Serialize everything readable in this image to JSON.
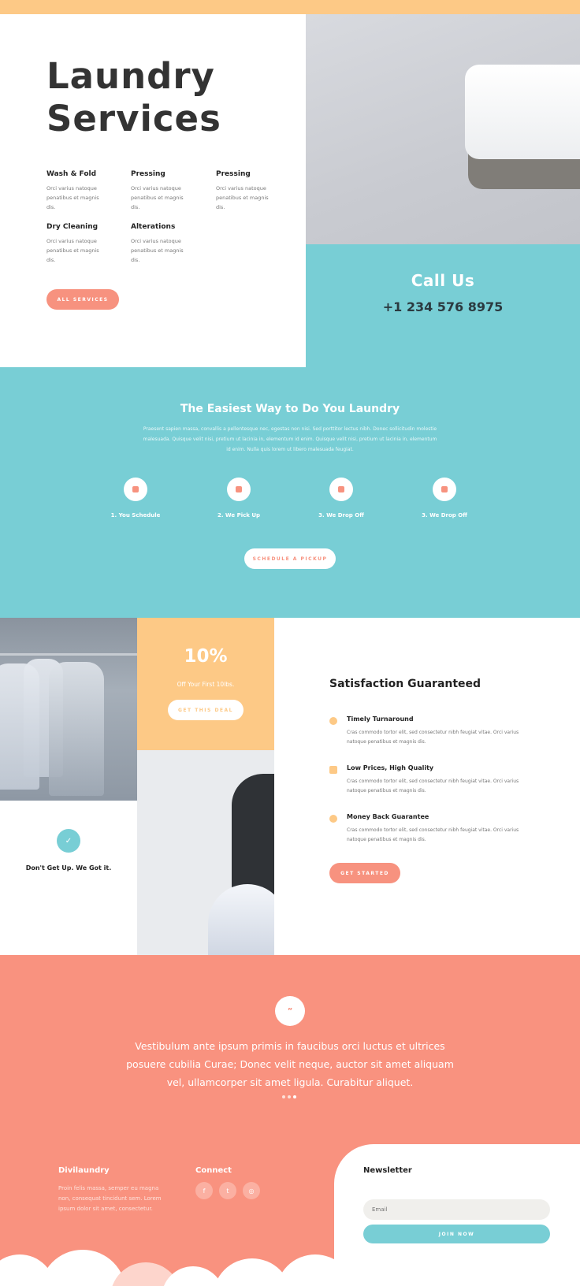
{
  "hero": {
    "title_line1": "Laundry",
    "title_line2": "Services",
    "services": [
      {
        "title": "Wash & Fold",
        "desc": "Orci varius natoque penatibus et magnis dis."
      },
      {
        "title": "Pressing",
        "desc": "Orci varius natoque penatibus et magnis dis."
      },
      {
        "title": "Pressing",
        "desc": "Orci varius natoque penatibus et magnis dis."
      },
      {
        "title": "Dry Cleaning",
        "desc": "Orci varius natoque penatibus et magnis dis."
      },
      {
        "title": "Alterations",
        "desc": "Orci varius natoque penatibus et magnis dis."
      }
    ],
    "button_label": "ALL SERVICES"
  },
  "call": {
    "title": "Call Us",
    "phone": "+1 234 576 8975"
  },
  "easy": {
    "title": "The Easiest Way to Do You Laundry",
    "text": "Praesent sapien massa, convallis a pellentesque nec, egestas non nisi. Sed porttitor lectus nibh. Donec sollicitudin molestie malesuada. Quisque velit nisi, pretium ut lacinia in, elementum id enim. Quisque velit nisi, pretium ut lacinia in, elementum id enim. Nulla quis lorem ut libero malesuada feugiat.",
    "steps": [
      {
        "label": "1. You Schedule",
        "icon": "calendar-icon"
      },
      {
        "label": "2. We Pick Up",
        "icon": "basket-icon"
      },
      {
        "label": "3. We Drop Off",
        "icon": "bag-icon"
      },
      {
        "label": "3. We Drop Off",
        "icon": "bag-icon"
      }
    ],
    "button_label": "SCHEDULE A PICKUP"
  },
  "deal": {
    "percent": "10%",
    "subtitle": "Off Your First 10lbs.",
    "button_label": "GET THIS DEAL"
  },
  "promise": {
    "icon": "check-icon",
    "check_glyph": "✓",
    "label": "Don't Get Up. We Got it."
  },
  "satisfaction": {
    "title": "Satisfaction Guaranteed",
    "features": [
      {
        "title": "Timely Turnaround",
        "desc": "Cras commodo tortor elit, sed consectetur nibh feugiat vitae. Orci varius natoque penatibus et magnis dis.",
        "icon": "clock-icon"
      },
      {
        "title": "Low Prices, High Quality",
        "desc": "Cras commodo tortor elit, sed consectetur nibh feugiat vitae. Orci varius natoque penatibus et magnis dis.",
        "icon": "tag-icon"
      },
      {
        "title": "Money Back Guarantee",
        "desc": "Cras commodo tortor elit, sed consectetur nibh feugiat vitae. Orci varius natoque penatibus et magnis dis.",
        "icon": "check-circle-icon"
      }
    ],
    "button_label": "GET STARTED"
  },
  "testimonial": {
    "quote_glyph": "”",
    "text": "Vestibulum ante ipsum primis in faucibus orci luctus et ultrices posuere cubilia Curae; Donec velit neque, auctor sit amet aliquam vel, ullamcorper sit amet ligula. Curabitur aliquet."
  },
  "footer": {
    "brand": "Divilaundry",
    "desc": "Proin felis massa, semper eu magna non, consequat tincidunt sem. Lorem ipsum dolor sit amet, consectetur.",
    "connect": "Connect",
    "social": [
      {
        "glyph": "f",
        "icon": "facebook-icon"
      },
      {
        "glyph": "t",
        "icon": "twitter-icon"
      },
      {
        "glyph": "◎",
        "icon": "instagram-icon"
      }
    ],
    "newsletter_title": "Newsletter",
    "email_placeholder": "Email",
    "join_label": "JOIN NOW"
  },
  "colors": {
    "peach": "#fdc986",
    "teal": "#78ced5",
    "coral": "#f9927f"
  }
}
